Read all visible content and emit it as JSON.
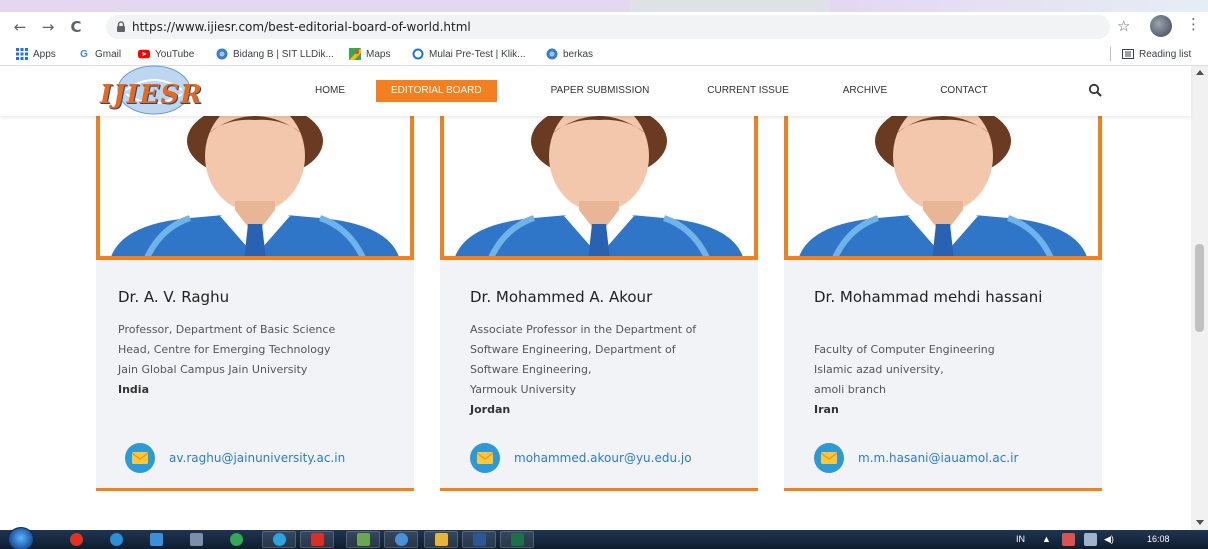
{
  "browser": {
    "url": "https://www.ijiesr.com/best-editorial-board-of-world.html",
    "back_icon": "←",
    "forward_icon": "→",
    "reload_icon": "C",
    "star_icon": "☆",
    "menu_icon": "⋮",
    "bookmarks": [
      {
        "label": "Apps",
        "icon": "apps-grid-icon"
      },
      {
        "label": "Gmail",
        "icon": "google-icon"
      },
      {
        "label": "YouTube",
        "icon": "youtube-icon"
      },
      {
        "label": "Bidang B | SIT LLDik...",
        "icon": "site-icon"
      },
      {
        "label": "Maps",
        "icon": "maps-icon"
      },
      {
        "label": "Mulai Pre-Test | Klik...",
        "icon": "circle-icon"
      },
      {
        "label": "berkas",
        "icon": "site-icon"
      }
    ],
    "reading_list": "Reading list"
  },
  "site": {
    "logo_text": "IJIESR",
    "nav": [
      {
        "label": "HOME",
        "active": false
      },
      {
        "label": "EDITORIAL BOARD",
        "active": true
      },
      {
        "label": "PAPER SUBMISSION",
        "active": false
      },
      {
        "label": "CURRENT ISSUE",
        "active": false
      },
      {
        "label": "ARCHIVE",
        "active": false
      },
      {
        "label": "CONTACT",
        "active": false
      }
    ],
    "accent_color": "#f47f1f",
    "link_color": "#2c7cc9"
  },
  "board": [
    {
      "name": "Dr. A. V. Raghu",
      "lines": [
        "Professor, Department of Basic Science",
        "Head, Centre for Emerging Technology",
        "Jain Global Campus Jain University"
      ],
      "country": "India",
      "email": "av.raghu@jainuniversity.ac.in"
    },
    {
      "name": "Dr. Mohammed A. Akour",
      "lines": [
        "Associate Professor in the Department of",
        "Software Engineering, Department of",
        "Software Engineering,",
        "Yarmouk University"
      ],
      "country": "Jordan",
      "email": "mohammed.akour@yu.edu.jo"
    },
    {
      "name": "Dr. Mohammad mehdi hassani",
      "lines": [
        "Faculty of Computer Engineering",
        "Islamic azad university,",
        "amoli branch"
      ],
      "country": "Iran",
      "email": "m.m.hasani@iauamol.ac.ir"
    }
  ],
  "taskbar": {
    "lang": "IN",
    "time": "16:08"
  }
}
